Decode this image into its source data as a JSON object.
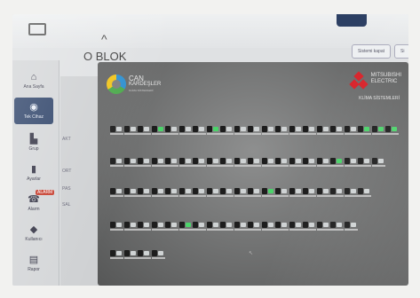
{
  "page": {
    "title": "O BLOK"
  },
  "toolbar": {
    "btn1": "Sistemi kapat",
    "btn2": "Si"
  },
  "sidebar": {
    "items": [
      {
        "label": "Ana Sayfa",
        "icon": "home-icon"
      },
      {
        "label": "Tek Cihaz",
        "icon": "device-icon"
      },
      {
        "label": "Grup",
        "icon": "building-icon"
      },
      {
        "label": "Ayarlar",
        "icon": "phone-icon"
      },
      {
        "label": "Alarm",
        "icon": "alarm-icon",
        "badge": "ALARM"
      },
      {
        "label": "Kullanıcı",
        "icon": "user-icon"
      },
      {
        "label": "Rapor",
        "icon": "report-icon"
      }
    ]
  },
  "left_panel": {
    "lines": [
      "AKT",
      "ORT",
      "PAS",
      "SAL"
    ]
  },
  "brand": {
    "can_name_1": "CAN",
    "can_name_2": "KARDEŞLER",
    "can_name_3": "KLİMA SİSTEMLERİ",
    "mitsu_1": "MITSUBISHI",
    "mitsu_2": "ELECTRIC",
    "mitsu_sub": "KLİMA SİSTEMLERİ"
  },
  "units": {
    "rows": [
      {
        "count": 21,
        "on": [
          3,
          7,
          18,
          19,
          20
        ]
      },
      {
        "count": 20,
        "on": [
          16
        ]
      },
      {
        "count": 19,
        "on": [
          11
        ]
      },
      {
        "count": 18,
        "on": [
          5
        ]
      },
      {
        "count": 4,
        "on": []
      }
    ]
  },
  "colors": {
    "accent": "#2d4268",
    "unit_on": "#4bd36a",
    "alarm": "#c53a2a"
  }
}
